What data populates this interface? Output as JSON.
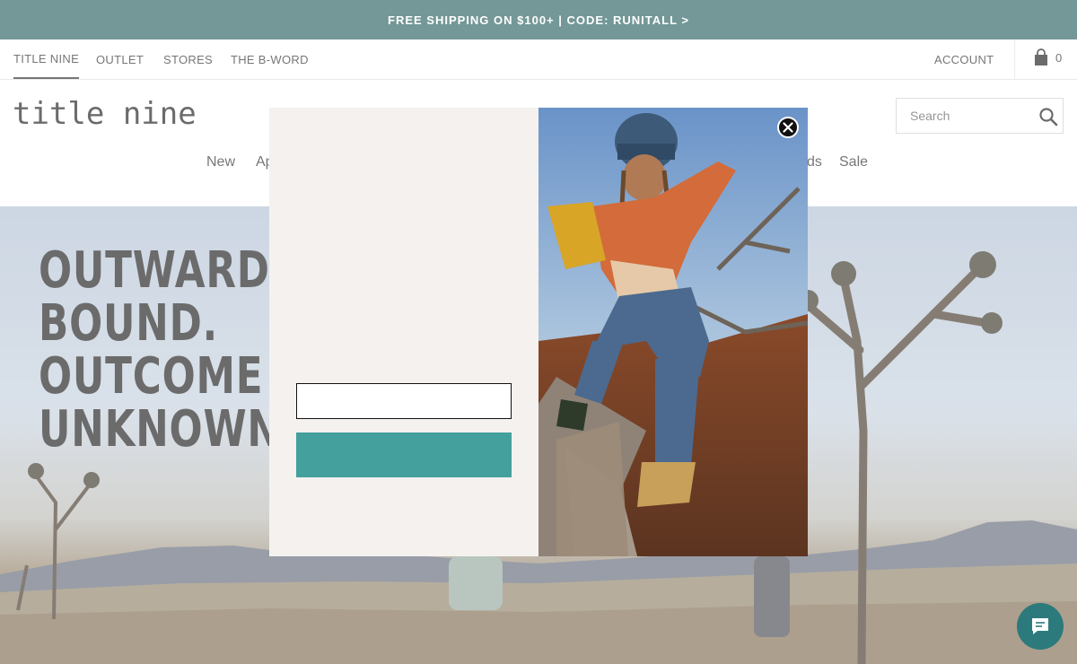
{
  "promo": {
    "text": "FREE SHIPPING ON $100+ | CODE: RUNITALL >"
  },
  "utility_nav": {
    "items": [
      "TITLE NINE",
      "OUTLET",
      "STORES",
      "THE B-WORD"
    ],
    "account_label": "ACCOUNT",
    "cart_count": "0"
  },
  "header": {
    "logo": "title nine",
    "search_placeholder": "Search"
  },
  "main_nav": {
    "visible_items": [
      "New",
      "Ap",
      "ds",
      "Sale"
    ]
  },
  "hero": {
    "headline_lines": [
      "OUTWARD",
      "BOUND.",
      "OUTCOME",
      "UNKNOWN."
    ]
  },
  "modal": {
    "email_placeholder": "",
    "submit_label": ""
  },
  "colors": {
    "promo_bg": "#1f5758",
    "submit_bg": "#44a09d",
    "modal_bg": "#f4f1ef",
    "chat_bg": "#2c7a7b"
  },
  "icons": {
    "cart": "shopping-bag-icon",
    "search": "magnifier-icon",
    "close": "close-icon",
    "chat": "chat-bubble-icon"
  }
}
